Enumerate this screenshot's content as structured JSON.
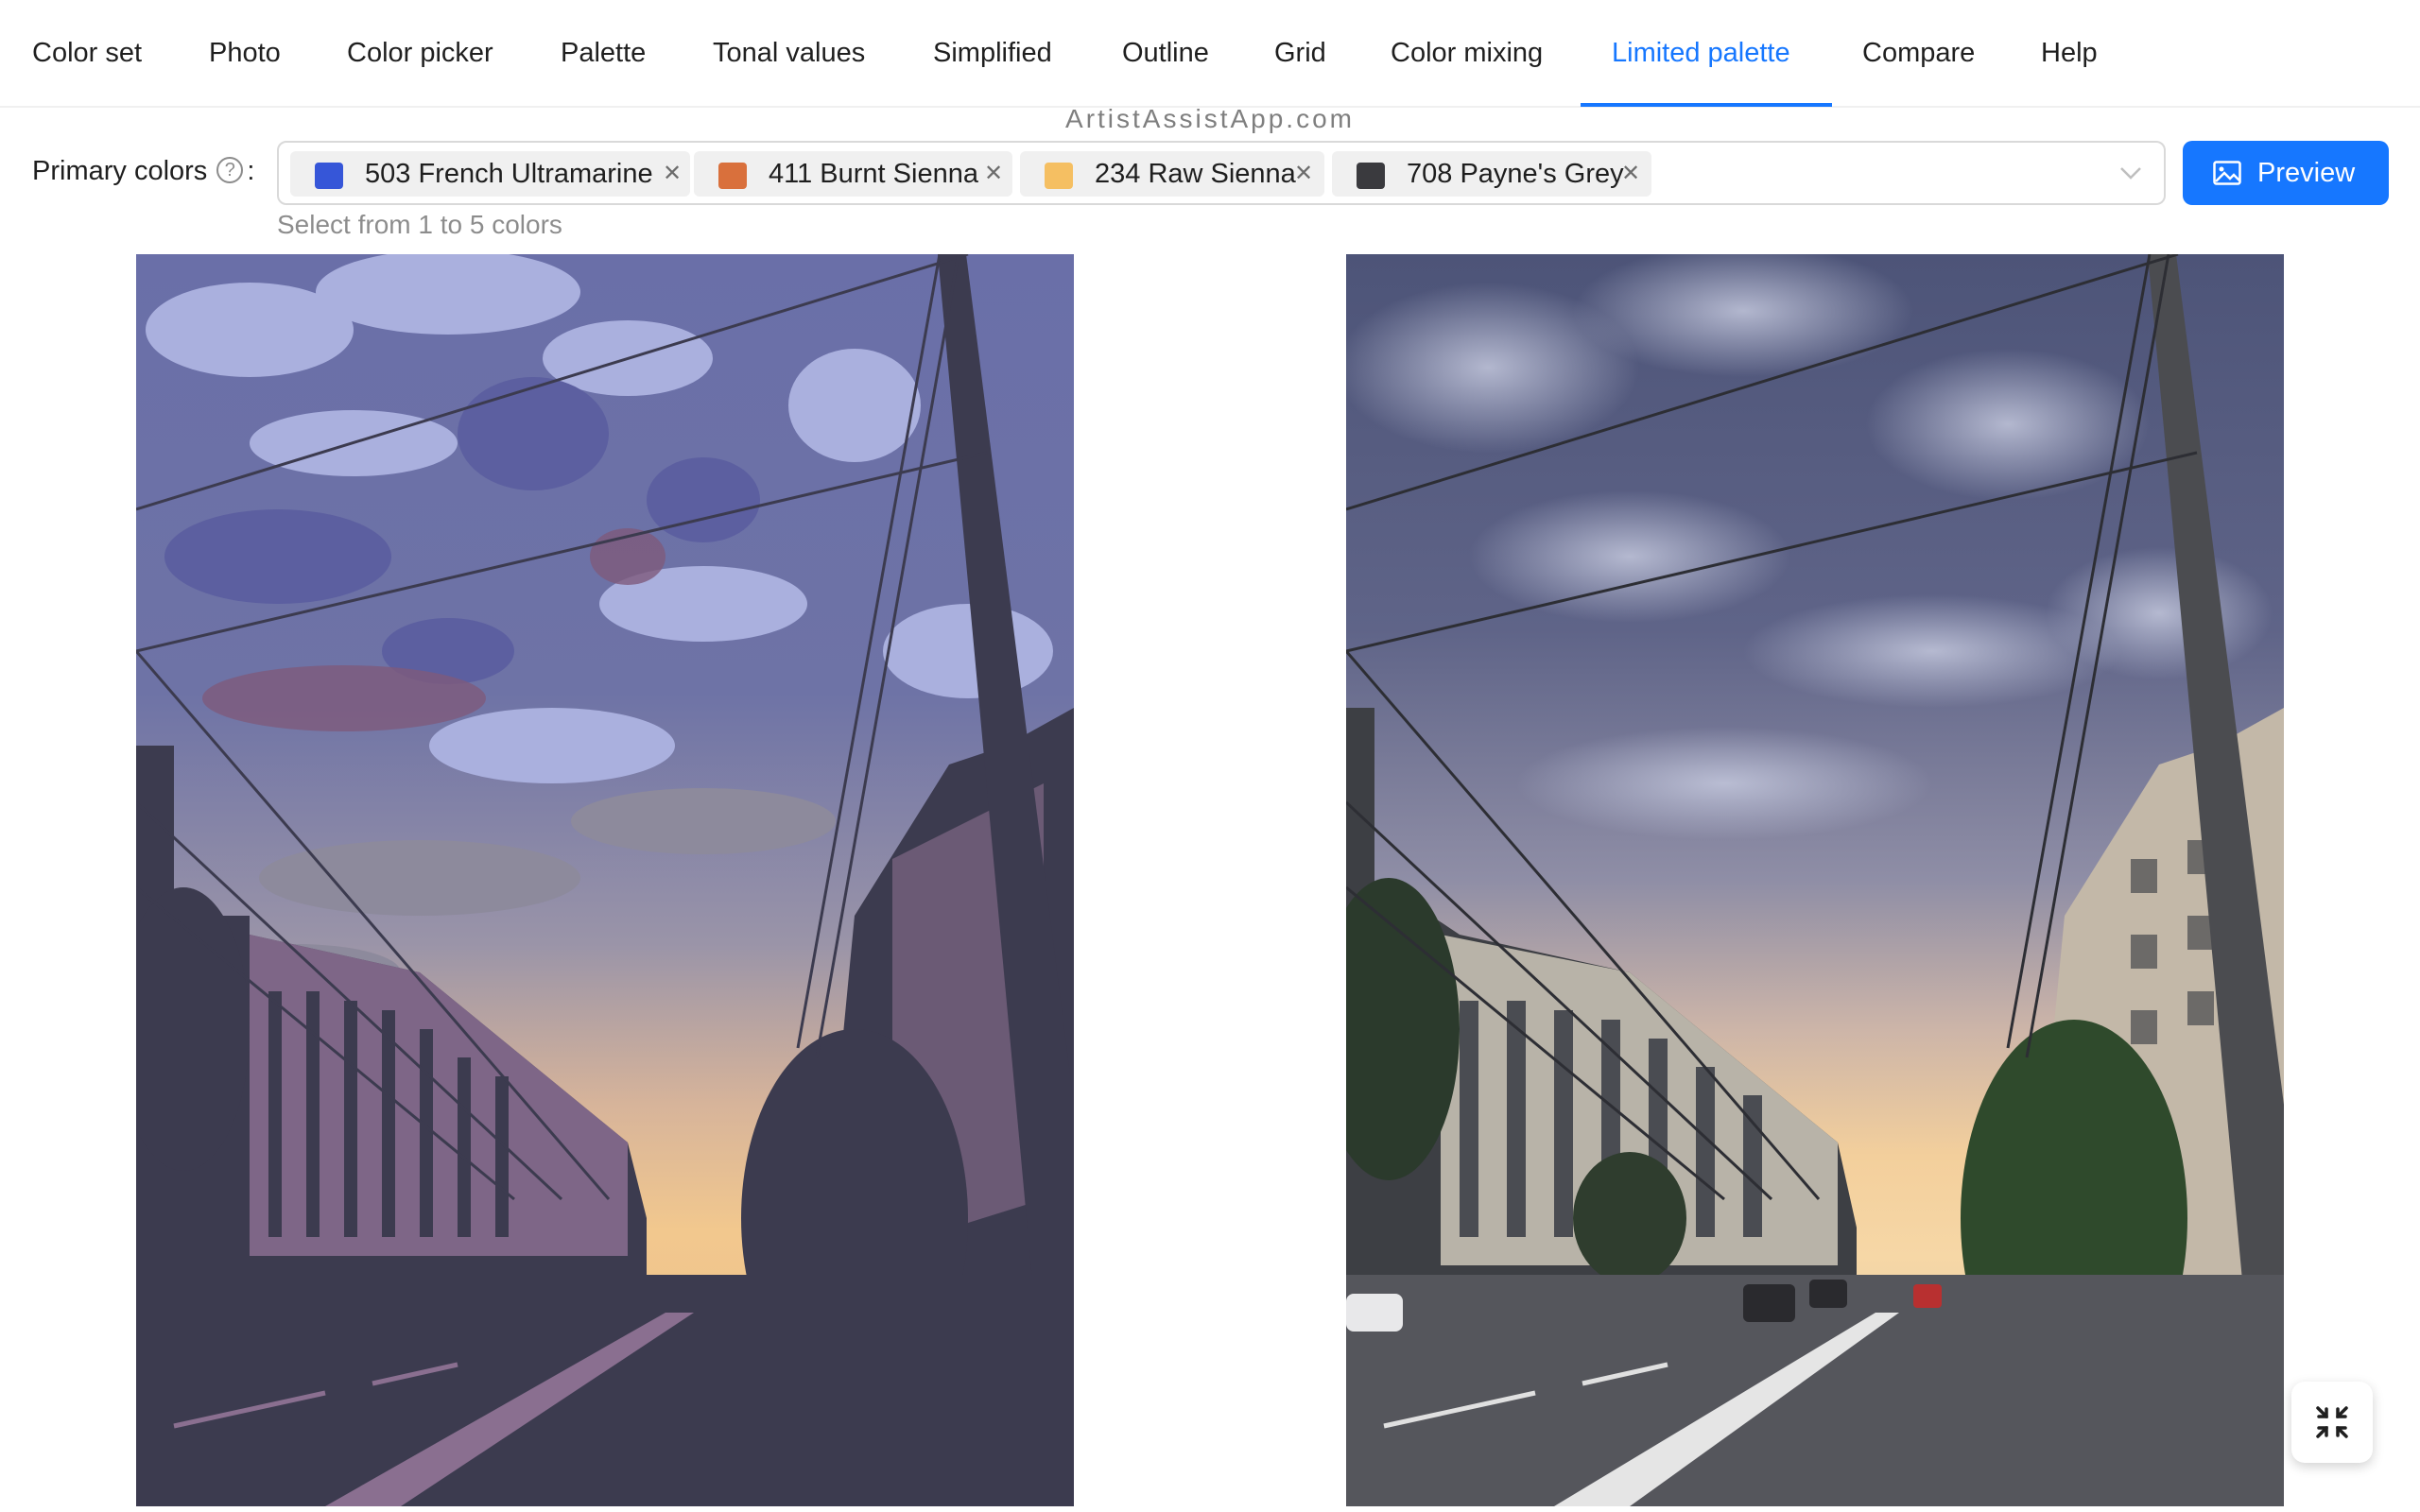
{
  "tabs": [
    {
      "label": "Color set",
      "active": false
    },
    {
      "label": "Photo",
      "active": false
    },
    {
      "label": "Color picker",
      "active": false
    },
    {
      "label": "Palette",
      "active": false
    },
    {
      "label": "Tonal values",
      "active": false
    },
    {
      "label": "Simplified",
      "active": false
    },
    {
      "label": "Outline",
      "active": false
    },
    {
      "label": "Grid",
      "active": false
    },
    {
      "label": "Color mixing",
      "active": false
    },
    {
      "label": "Limited palette",
      "active": true
    },
    {
      "label": "Compare",
      "active": false
    },
    {
      "label": "Help",
      "active": false
    }
  ],
  "watermark": "ArtistAssistApp.com",
  "primary_colors": {
    "label": "Primary colors",
    "help_icon": "question-circle-icon",
    "colon": ":",
    "hint": "Select from 1 to 5 colors",
    "selected": [
      {
        "label": "503 French Ultramarine",
        "color": "#3656d8"
      },
      {
        "label": "411 Burnt Sienna",
        "color": "#d9703c"
      },
      {
        "label": "234 Raw Sienna",
        "color": "#f5bf62"
      },
      {
        "label": "708 Payne's Grey",
        "color": "#3a3a3e"
      }
    ],
    "dropdown_icon": "chevron-down-icon"
  },
  "preview_button": {
    "label": "Preview",
    "icon": "picture-icon"
  },
  "fullscreen_button": {
    "icon": "fullscreen-exit-icon"
  },
  "colors": {
    "accent": "#1677ff"
  }
}
